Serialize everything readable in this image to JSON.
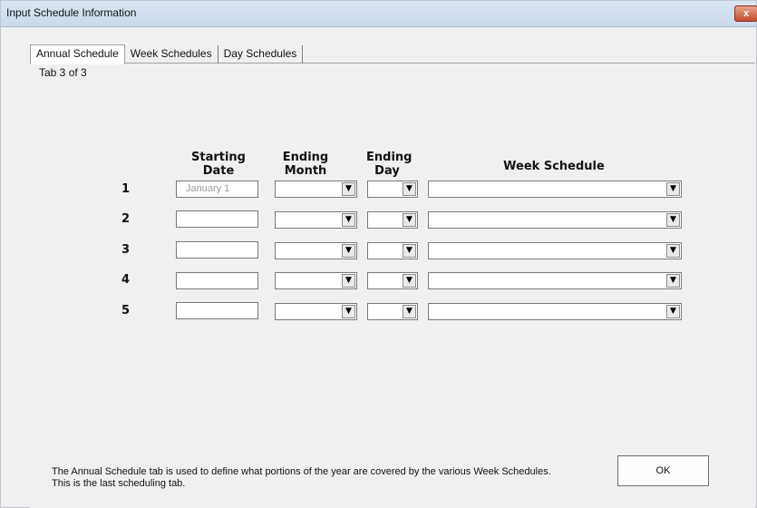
{
  "window": {
    "title": "Input Schedule Information",
    "close_label": "x"
  },
  "tabs": [
    {
      "label": "Annual Schedule"
    },
    {
      "label": "Week Schedules"
    },
    {
      "label": "Day Schedules"
    }
  ],
  "tab_info": "Tab 3 of 3",
  "headers": {
    "starting_date": "Starting Date",
    "ending_month": "Ending Month",
    "ending_day": "Ending Day",
    "week_schedule": "Week Schedule"
  },
  "rows": [
    {
      "number": "1",
      "starting_date": "January 1",
      "ending_month": "",
      "ending_day": "",
      "week_schedule": ""
    },
    {
      "number": "2",
      "starting_date": "",
      "ending_month": "",
      "ending_day": "",
      "week_schedule": ""
    },
    {
      "number": "3",
      "starting_date": "",
      "ending_month": "",
      "ending_day": "",
      "week_schedule": ""
    },
    {
      "number": "4",
      "starting_date": "",
      "ending_month": "",
      "ending_day": "",
      "week_schedule": ""
    },
    {
      "number": "5",
      "starting_date": "",
      "ending_month": "",
      "ending_day": "",
      "week_schedule": ""
    }
  ],
  "dropdown_arrow": "▼",
  "description": {
    "line1": "The Annual Schedule tab is used to define what portions of the year are covered by the various Week Schedules.",
    "line2": "This is the last scheduling tab."
  },
  "ok_label": "OK"
}
